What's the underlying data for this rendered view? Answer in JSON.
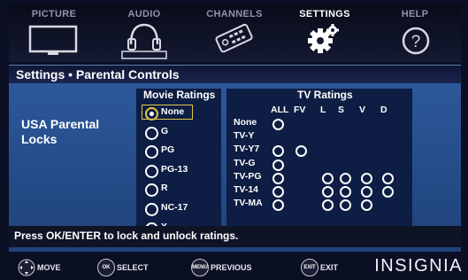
{
  "menu": {
    "tabs": [
      {
        "label": "PICTURE",
        "icon": "tv-icon"
      },
      {
        "label": "AUDIO",
        "icon": "headphones-icon"
      },
      {
        "label": "CHANNELS",
        "icon": "remote-control-icon"
      },
      {
        "label": "SETTINGS",
        "icon": "gear-icon"
      },
      {
        "label": "HELP",
        "icon": "help-icon"
      }
    ],
    "active": "SETTINGS"
  },
  "panel": {
    "title": "Settings • Parental Controls",
    "section_label": "USA Parental Locks"
  },
  "movie_ratings": {
    "heading": "Movie Ratings",
    "items": [
      "None",
      "G",
      "PG",
      "PG-13",
      "R",
      "NC-17",
      "X"
    ],
    "selected": "None"
  },
  "tv_ratings": {
    "heading": "TV Ratings",
    "columns": [
      "ALL",
      "FV",
      "L",
      "S",
      "V",
      "D"
    ],
    "rows": [
      {
        "label": "None",
        "cells": [
          "ALL"
        ]
      },
      {
        "label": "TV-Y",
        "cells": []
      },
      {
        "label": "TV-Y7",
        "cells": [
          "ALL",
          "FV"
        ]
      },
      {
        "label": "TV-G",
        "cells": [
          "ALL"
        ]
      },
      {
        "label": "TV-PG",
        "cells": [
          "ALL",
          "L",
          "S",
          "V",
          "D"
        ]
      },
      {
        "label": "TV-14",
        "cells": [
          "ALL",
          "L",
          "S",
          "V",
          "D"
        ]
      },
      {
        "label": "TV-MA",
        "cells": [
          "ALL",
          "L",
          "S",
          "V"
        ]
      }
    ]
  },
  "status": "Press OK/ENTER to lock and unlock ratings.",
  "hints": [
    {
      "button": "",
      "label": "MOVE"
    },
    {
      "button": "OK ENTER",
      "label": "SELECT"
    },
    {
      "button": "MENU",
      "label": "PREVIOUS"
    },
    {
      "button": "EXIT",
      "label": "EXIT"
    }
  ],
  "brand": "INSIGNIA"
}
